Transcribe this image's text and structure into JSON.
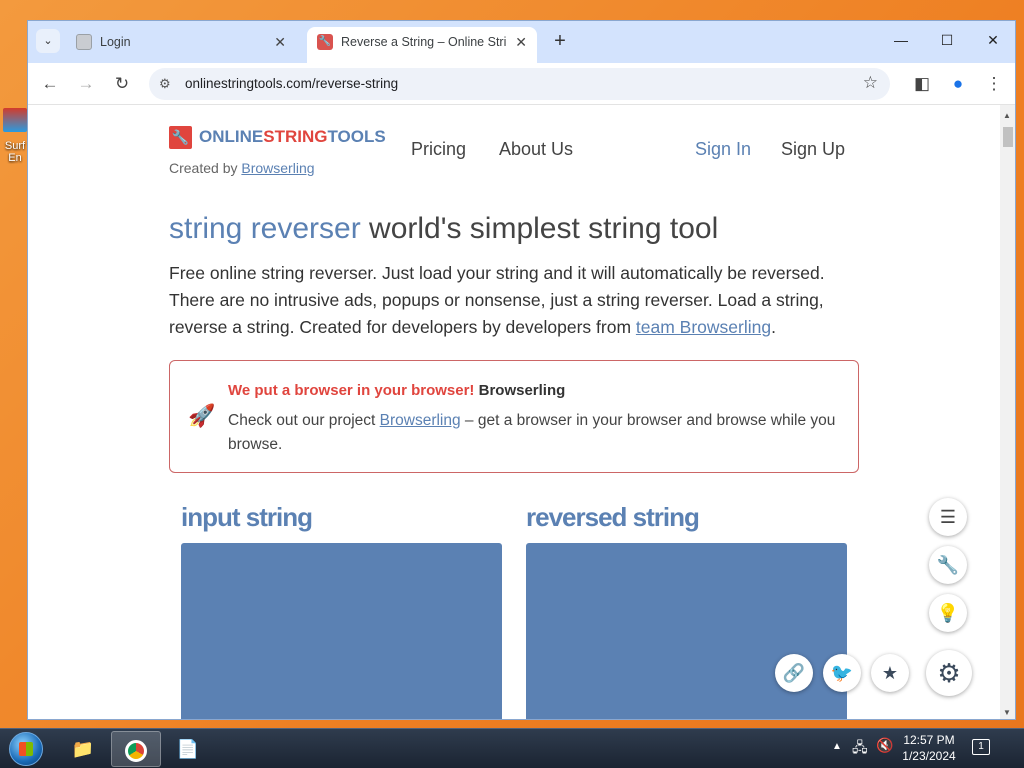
{
  "desktop": {
    "icon_label": "Surf\nEn"
  },
  "browser": {
    "tabs": [
      {
        "title": "Login"
      },
      {
        "title": "Reverse a String – Online String"
      }
    ],
    "address": "onlinestringtools.com/reverse-string"
  },
  "site": {
    "logo": {
      "part1": "ONLINE",
      "part2": "STRING",
      "part3": "TOOLS"
    },
    "created_by": "Created by",
    "created_by_link": "Browserling",
    "nav": {
      "pricing": "Pricing",
      "about": "About Us",
      "sign_in": "Sign In",
      "sign_up": "Sign Up"
    },
    "headline_highlight": "string reverser",
    "headline_rest": " world's simplest string tool",
    "intro_text": "Free online string reverser. Just load your string and it will automatically be reversed. There are no intrusive ads, popups or nonsense, just a string reverser. Load a string, reverse a string. Created for developers by developers from ",
    "intro_link": "team Browserling",
    "intro_end": ".",
    "promo": {
      "heading": "We put a browser in your browser!",
      "heading_brand": " Browserling",
      "text_start": "Check out our project ",
      "text_link": "Browserling",
      "text_end": " – get a browser in your browser and browse while you browse."
    },
    "input_title": "input string",
    "output_title": "reversed string"
  },
  "colors": {
    "accent": "#5b81b3",
    "brand_red": "#e0453e"
  },
  "icons": {
    "side_fabs": [
      "list-icon",
      "wrench-icon",
      "lightbulb-icon"
    ],
    "bottom_fabs": [
      "link-icon",
      "twitter-icon",
      "star-icon",
      "gear-icon"
    ]
  },
  "taskbar": {
    "time": "12:57 PM",
    "date": "1/23/2024",
    "notifications": "1"
  }
}
